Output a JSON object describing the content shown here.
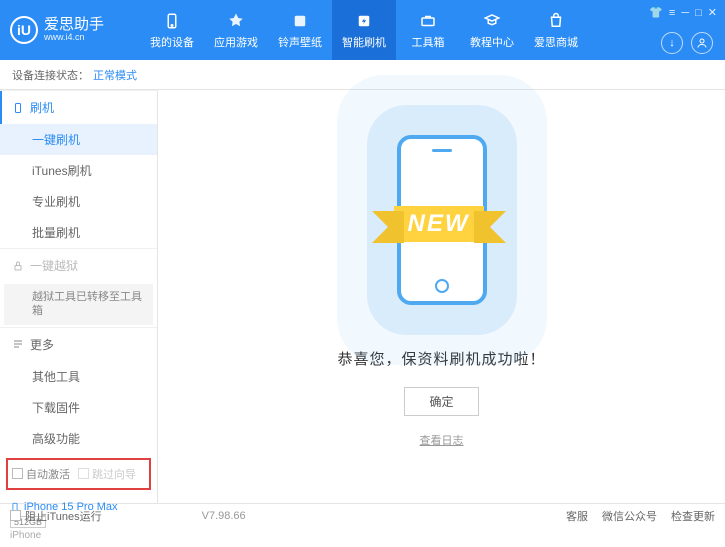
{
  "header": {
    "logo_badge": "iU",
    "logo_main": "爱思助手",
    "logo_sub": "www.i4.cn",
    "tabs": [
      {
        "label": "我的设备"
      },
      {
        "label": "应用游戏"
      },
      {
        "label": "铃声壁纸"
      },
      {
        "label": "智能刷机"
      },
      {
        "label": "工具箱"
      },
      {
        "label": "教程中心"
      },
      {
        "label": "爱思商城"
      }
    ]
  },
  "status": {
    "label": "设备连接状态：",
    "mode": "正常模式"
  },
  "sidebar": {
    "flash_section": "刷机",
    "flash_items": [
      "一键刷机",
      "iTunes刷机",
      "专业刷机",
      "批量刷机"
    ],
    "jailbreak_section": "一键越狱",
    "jailbreak_note": "越狱工具已转移至工具箱",
    "more_section": "更多",
    "more_items": [
      "其他工具",
      "下载固件",
      "高级功能"
    ],
    "checkboxes": {
      "auto_activate": "自动激活",
      "skip_guide": "跳过向导"
    },
    "device": {
      "name": "iPhone 15 Pro Max",
      "storage": "512GB",
      "type": "iPhone"
    }
  },
  "main": {
    "ribbon": "NEW",
    "success": "恭喜您，保资料刷机成功啦！",
    "ok": "确定",
    "log": "查看日志"
  },
  "footer": {
    "block_itunes": "阻止iTunes运行",
    "version": "V7.98.66",
    "links": [
      "客服",
      "微信公众号",
      "检查更新"
    ]
  }
}
